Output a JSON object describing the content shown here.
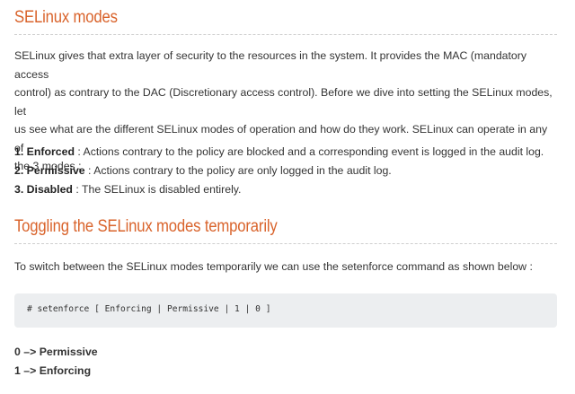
{
  "section1": {
    "heading": "SELinux modes",
    "intro_lines": [
      "SELinux gives that extra layer of security to the resources in the system. It provides the MAC (mandatory access",
      "control) as contrary to the DAC (Discretionary access control). Before we dive into setting the SELinux modes, let",
      "us see what are the different SELinux modes of operation and how do they work. SELinux can operate in any of",
      "the 3 modes :"
    ],
    "modes": [
      {
        "label": "1. Enforced",
        "desc": " : Actions contrary to the policy are blocked and a corresponding event is logged in the audit log."
      },
      {
        "label": "2. Permissive",
        "desc": " : Actions contrary to the policy are only logged in the audit log."
      },
      {
        "label": "3. Disabled",
        "desc": " : The SELinux is disabled entirely."
      }
    ]
  },
  "section2": {
    "heading": "Toggling the SELinux modes temporarily",
    "intro": "To switch between the SELinux modes temporarily we can use the setenforce command as shown below :",
    "code": "# setenforce [ Enforcing | Permissive | 1 | 0 ]",
    "mapping": [
      "0 –> Permissive",
      "1 –> Enforcing"
    ]
  }
}
